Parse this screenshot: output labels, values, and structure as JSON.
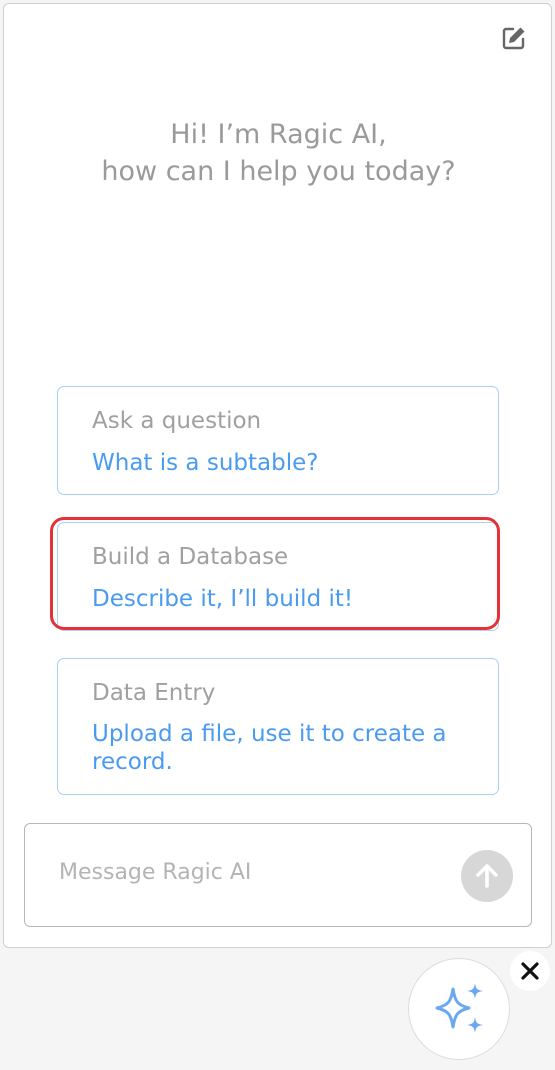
{
  "header": {
    "edit_icon": "edit-pencil-icon"
  },
  "greeting": {
    "line1": "Hi! I’m Ragic AI,",
    "line2": "how can I help you today?"
  },
  "suggestions": [
    {
      "title": "Ask a question",
      "subtitle": "What is a subtable?"
    },
    {
      "title": "Build a Database",
      "subtitle": "Describe it, I’ll build it!"
    },
    {
      "title": "Data Entry",
      "subtitle": "Upload a file, use it to create a record."
    }
  ],
  "composer": {
    "placeholder": "Message Ragic AI",
    "send_icon": "arrow-up-icon"
  },
  "launcher": {
    "icon": "sparkles-icon",
    "close_icon": "close-icon"
  },
  "colors": {
    "accent_blue": "#4a9bef",
    "card_border": "#a9d0f7",
    "highlight_red": "#e53238",
    "muted_text": "#9a9a9a"
  }
}
